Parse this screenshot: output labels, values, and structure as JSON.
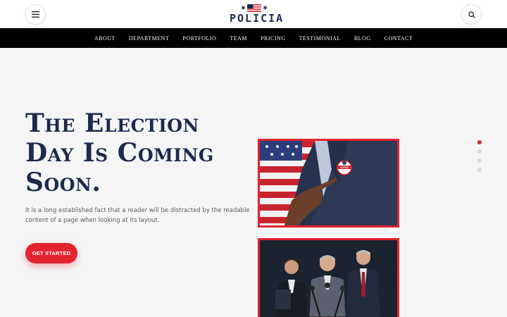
{
  "header": {
    "logo_text": "POLICIA",
    "menu_icon": "hamburger-menu-icon",
    "search_icon": "search-icon"
  },
  "nav": {
    "items": [
      "ABOUT",
      "DEPARTMENT",
      "PORTFOLIO",
      "TEAM",
      "PRICING",
      "TESTIMONIAL",
      "BLOG",
      "CONTACT"
    ]
  },
  "hero": {
    "title_lines": [
      "The Election",
      "Day Is Coming",
      "Soon."
    ],
    "description": "It is a long established fact that a reader will be distracted by the readable content of a page when looking at its layout.",
    "cta_label": "GET STARTED",
    "badge_text": "VOTED"
  },
  "slider": {
    "total": 4,
    "active": 1
  },
  "colors": {
    "accent": "#e3232e",
    "navy": "#1b2a4e",
    "navbar": "#000000",
    "background": "#f5f5f6"
  }
}
